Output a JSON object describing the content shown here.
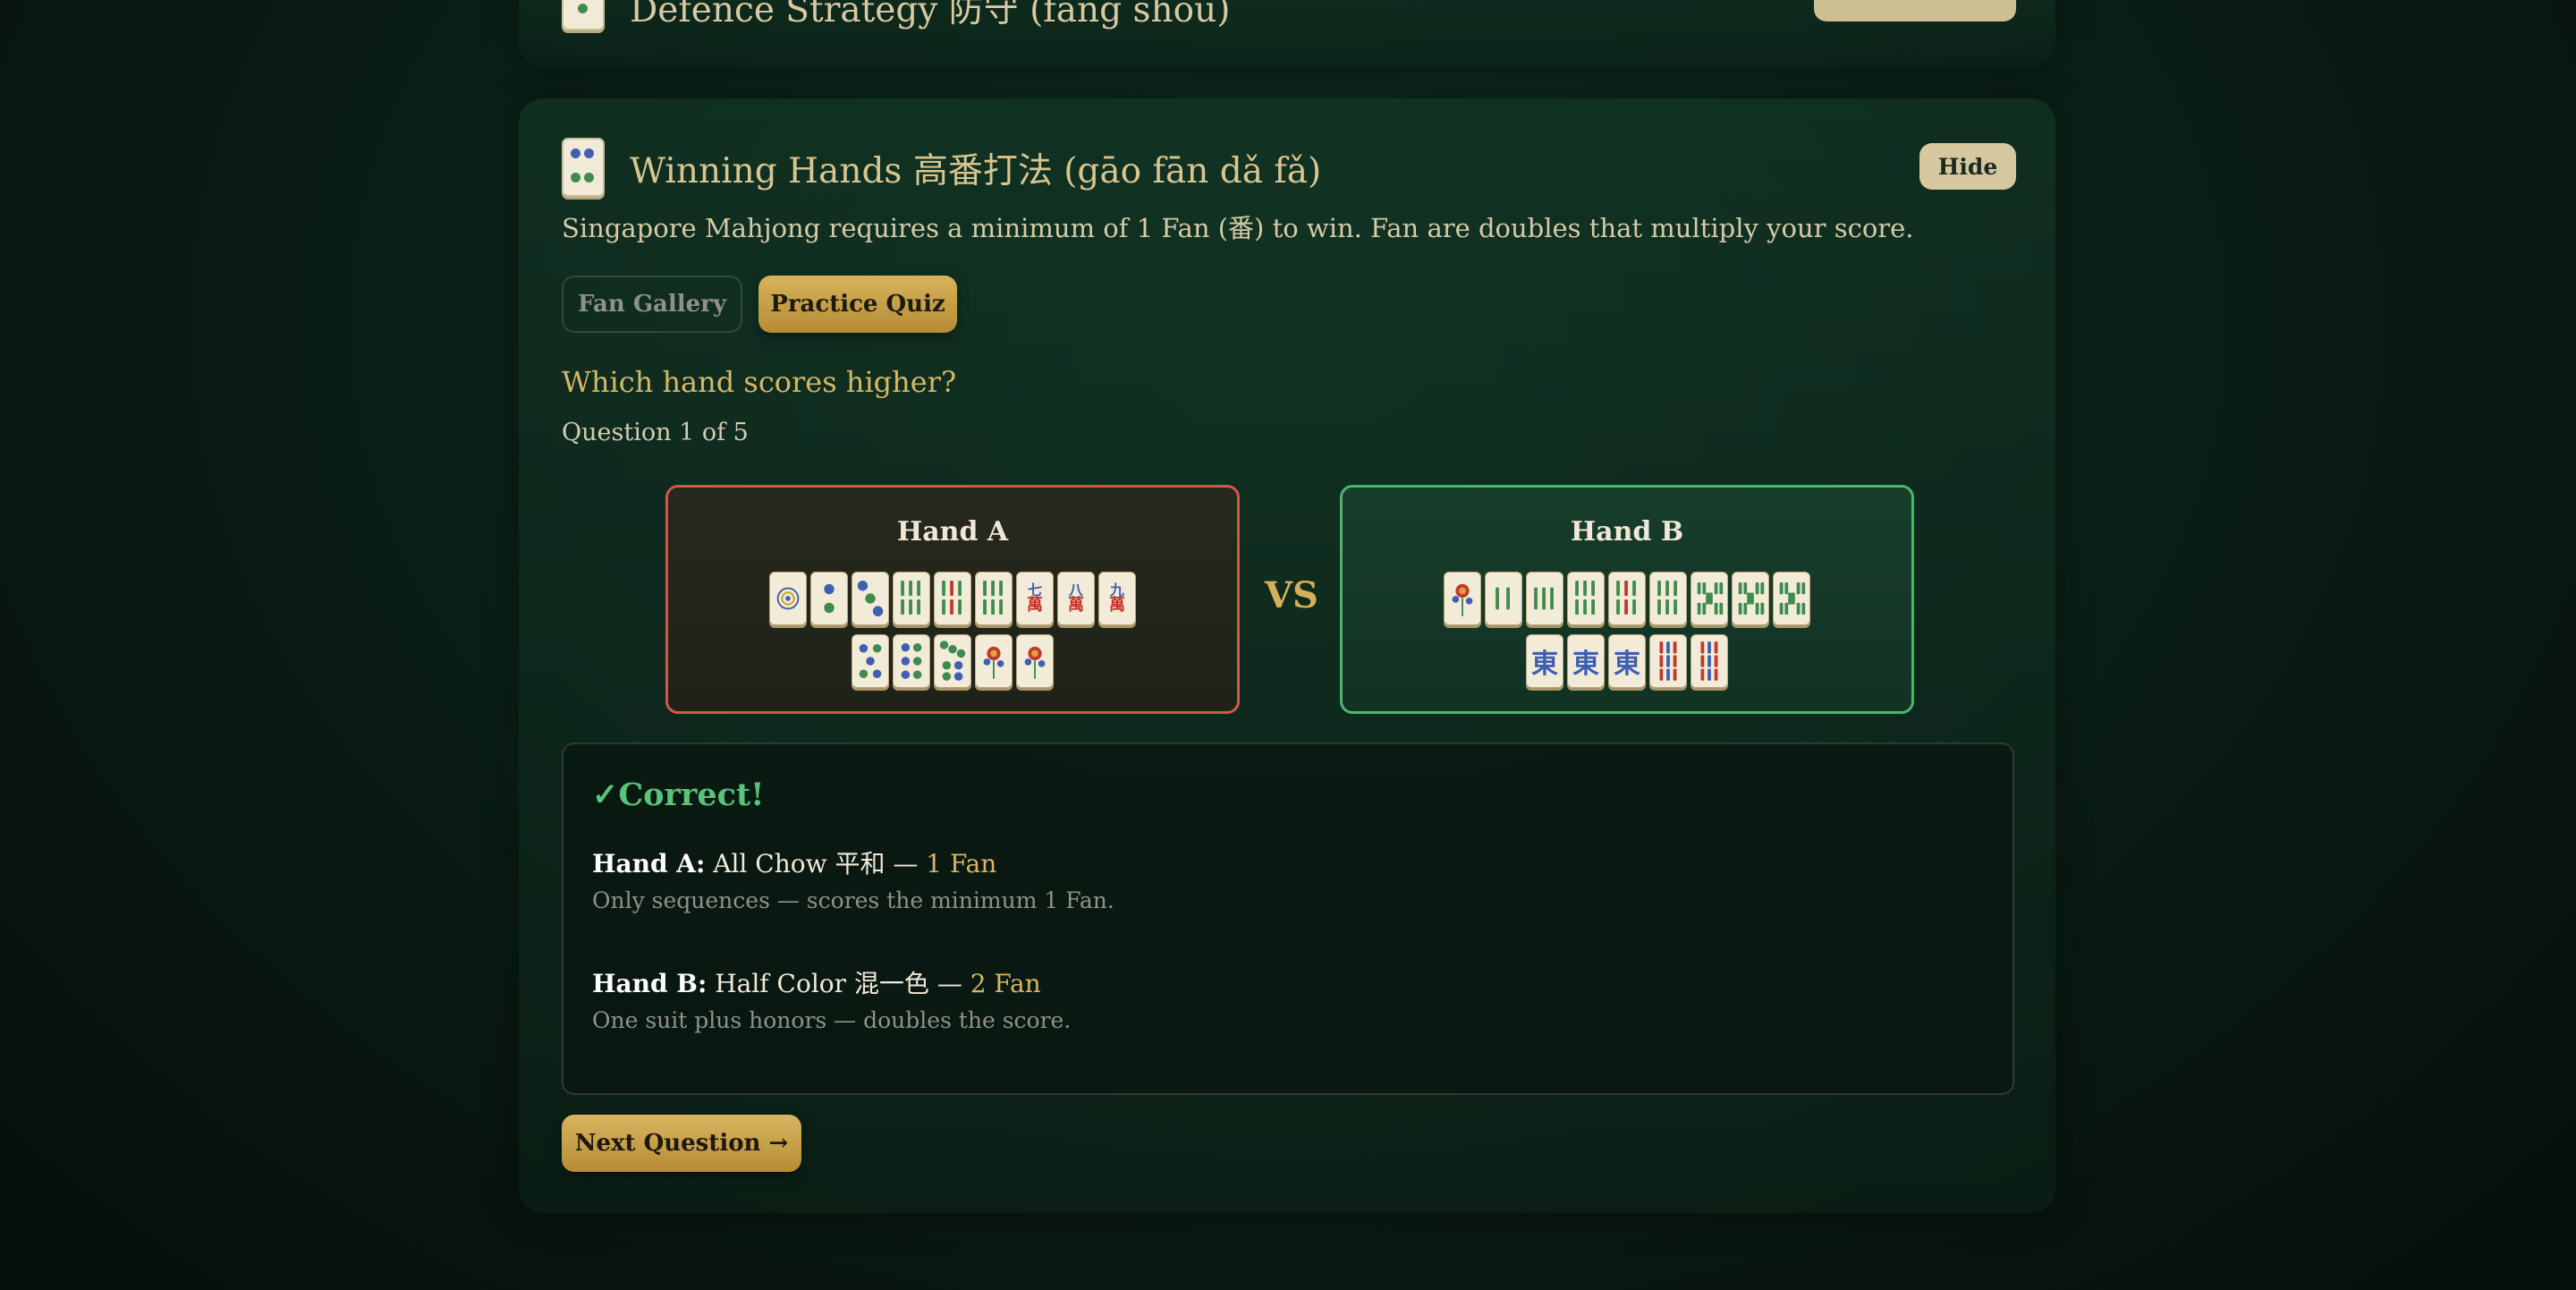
{
  "previous_section": {
    "title": "Defence Strategy 防守 (fáng shǒu)"
  },
  "section": {
    "title": "Winning Hands 高番打法 (gāo fān dǎ fǎ)",
    "hide_label": "Hide",
    "description": "Singapore Mahjong requires a minimum of 1 Fan (番) to win. Fan are doubles that multiply your score."
  },
  "tabs": [
    {
      "label": "Fan Gallery",
      "active": false
    },
    {
      "label": "Practice Quiz",
      "active": true
    }
  ],
  "quiz": {
    "question": "Which hand scores higher?",
    "progress": "Question 1 of 5",
    "vs_label": "VS",
    "hand_a": {
      "label": "Hand A",
      "status": "incorrect-choice",
      "row1": [
        "circles-1",
        "circles-2",
        "circles-3",
        "bamboo-4",
        "bamboo-5",
        "bamboo-6",
        "characters-7",
        "characters-8",
        "characters-9"
      ],
      "row2": [
        "circles-5",
        "circles-6",
        "circles-7",
        "flower",
        "flower"
      ]
    },
    "hand_b": {
      "label": "Hand B",
      "status": "correct-choice",
      "row1": [
        "flower",
        "bamboo-2",
        "bamboo-3",
        "bamboo-4",
        "bamboo-5",
        "bamboo-6",
        "bamboo-8",
        "bamboo-8",
        "bamboo-8"
      ],
      "row2": [
        "east-wind",
        "east-wind",
        "east-wind",
        "bamboo-9",
        "bamboo-9"
      ]
    }
  },
  "result": {
    "heading": "✓Correct!",
    "hand_a": {
      "prefix": "Hand A:",
      "name": "All Chow 平和 — ",
      "fan": "1 Fan",
      "note": "Only sequences — scores the minimum 1 Fan."
    },
    "hand_b": {
      "prefix": "Hand B:",
      "name": "Half Color 混一色 — ",
      "fan": "2 Fan",
      "note": "One suit plus honors — doubles the score."
    }
  },
  "next_label": "Next Question →",
  "tile_glyphs": {
    "characters-7": "七",
    "characters-8": "八",
    "characters-9": "九",
    "east-wind": "東",
    "man": "萬"
  },
  "colors": {
    "accent_gold": "#d7b25c",
    "correct_green": "#4db56b",
    "wrong_red": "#d1574a",
    "tile_face": "#f2ebd8",
    "bamboo_green": "#3f8b4e",
    "circle_blue": "#3f5fb0",
    "character_red": "#c0392b"
  }
}
